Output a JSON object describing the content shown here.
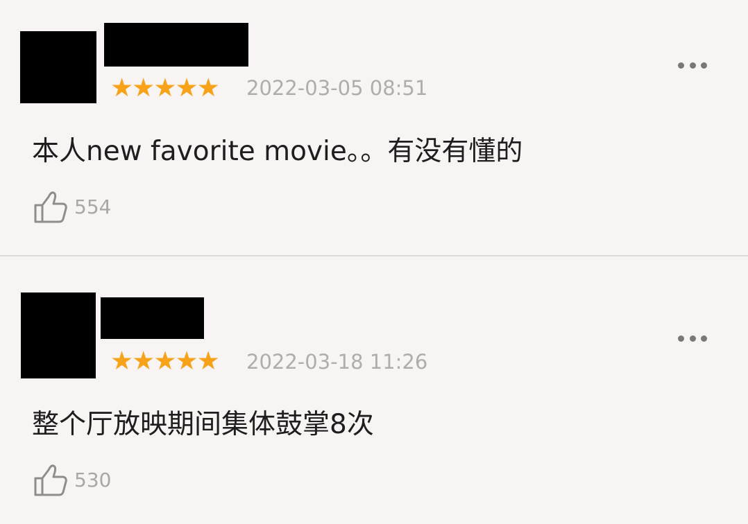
{
  "comments": [
    {
      "rating_stars": "★★★★★",
      "rating": 5,
      "timestamp": "2022-03-05 08:51",
      "text": "本人new favorite movie。。有没有懂的",
      "likes": "554"
    },
    {
      "rating_stars": "★★★★★",
      "rating": 5,
      "timestamp": "2022-03-18 11:26",
      "text": "整个厅放映期间集体鼓掌8次",
      "likes": "530"
    }
  ],
  "icons": {
    "like": "thumbs-up-icon",
    "more": "more-options-icon"
  },
  "colors": {
    "background": "#f7f4f3",
    "star": "#f8a21a",
    "text": "#1e1e1e",
    "meta": "#b0acab"
  }
}
